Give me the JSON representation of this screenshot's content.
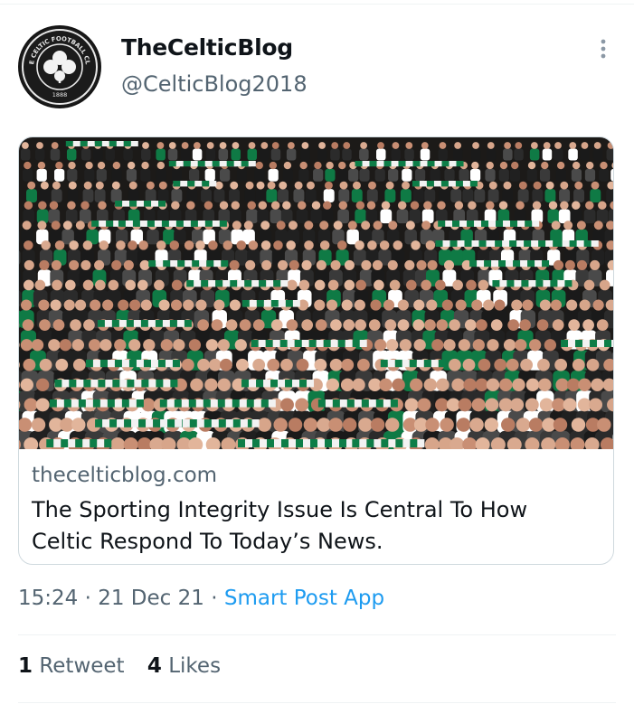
{
  "tweet": {
    "author": {
      "display_name": "TheCelticBlog",
      "handle": "@CelticBlog2018",
      "avatar_icon": "celtic-crest-icon",
      "avatar_text": "THE CELTIC FOOTBALL CLUB",
      "avatar_year": "1888"
    },
    "card": {
      "image_icon": "crowd-photo",
      "domain": "thecelticblog.com",
      "title": "The Sporting Integrity Issue Is Central To How Celtic Respond To Today’s News."
    },
    "meta": {
      "time": "15:24",
      "date": "21 Dec 21",
      "source": "Smart Post App"
    },
    "stats": {
      "retweet_count": "1",
      "retweet_label": "Retweet",
      "like_count": "4",
      "like_label": "Likes"
    },
    "colors": {
      "link": "#1d9bf0",
      "secondary_text": "#536471",
      "celtic_green": "#008a4b"
    }
  }
}
